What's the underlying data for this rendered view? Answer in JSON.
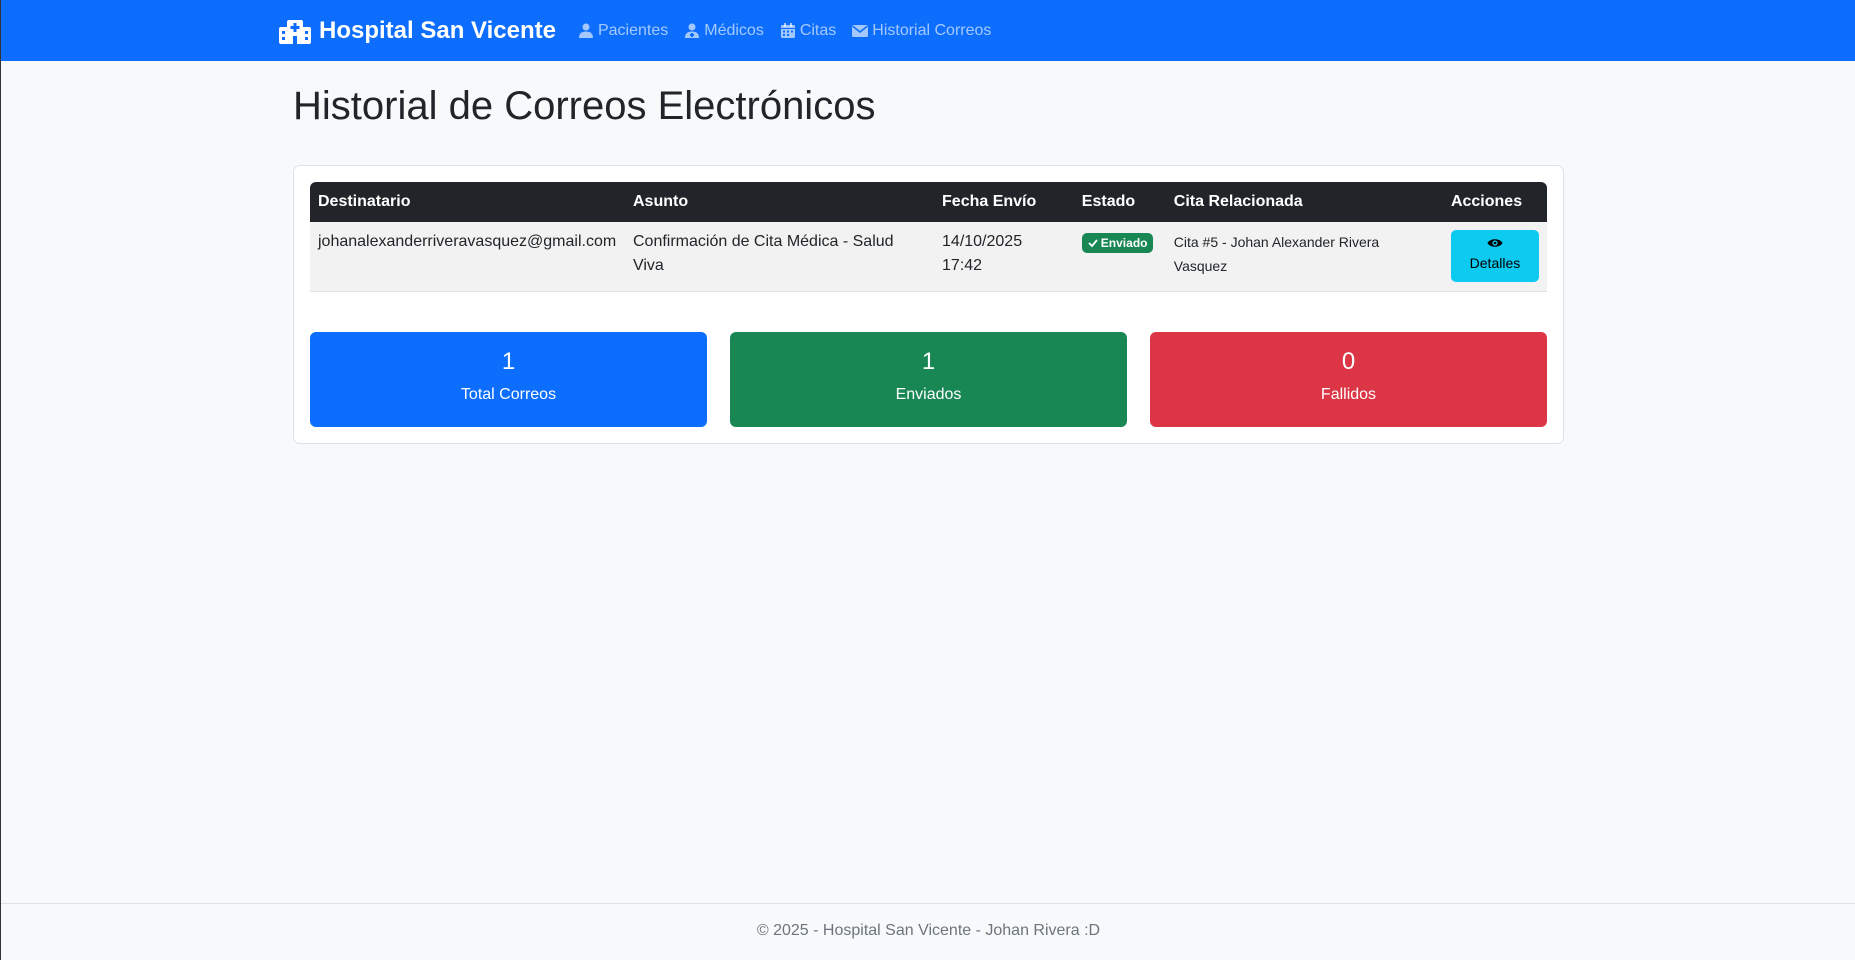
{
  "navbar": {
    "brand": "Hospital San Vicente",
    "brand_icon": "hospital-icon",
    "links": [
      {
        "label": "Pacientes",
        "icon": "user-injured-icon"
      },
      {
        "label": "Médicos",
        "icon": "user-doctor-icon"
      },
      {
        "label": "Citas",
        "icon": "calendar-icon"
      },
      {
        "label": "Historial Correos",
        "icon": "envelope-icon"
      }
    ],
    "color": "#0d6efd"
  },
  "page": {
    "title": "Historial de Correos Electrónicos"
  },
  "table": {
    "headers": [
      "Destinatario",
      "Asunto",
      "Fecha Envío",
      "Estado",
      "Cita Relacionada",
      "Acciones"
    ],
    "rows": [
      {
        "recipient": "johanalexanderriveravasquez@gmail.com",
        "subject": "Confirmación de Cita Médica - Salud Viva",
        "date": "14/10/2025",
        "time": "17:42",
        "status": "Enviado",
        "appointment": "Cita #5 - Johan Alexander Rivera Vasquez",
        "action": "Detalles"
      }
    ]
  },
  "stats": [
    {
      "value": "1",
      "label": "Total Correos",
      "color": "#0d6efd"
    },
    {
      "value": "1",
      "label": "Enviados",
      "color": "#198754"
    },
    {
      "value": "0",
      "label": "Fallidos",
      "color": "#dc3545"
    }
  ],
  "footer": {
    "text": "© 2025 - Hospital San Vicente - Johan Rivera :D"
  }
}
